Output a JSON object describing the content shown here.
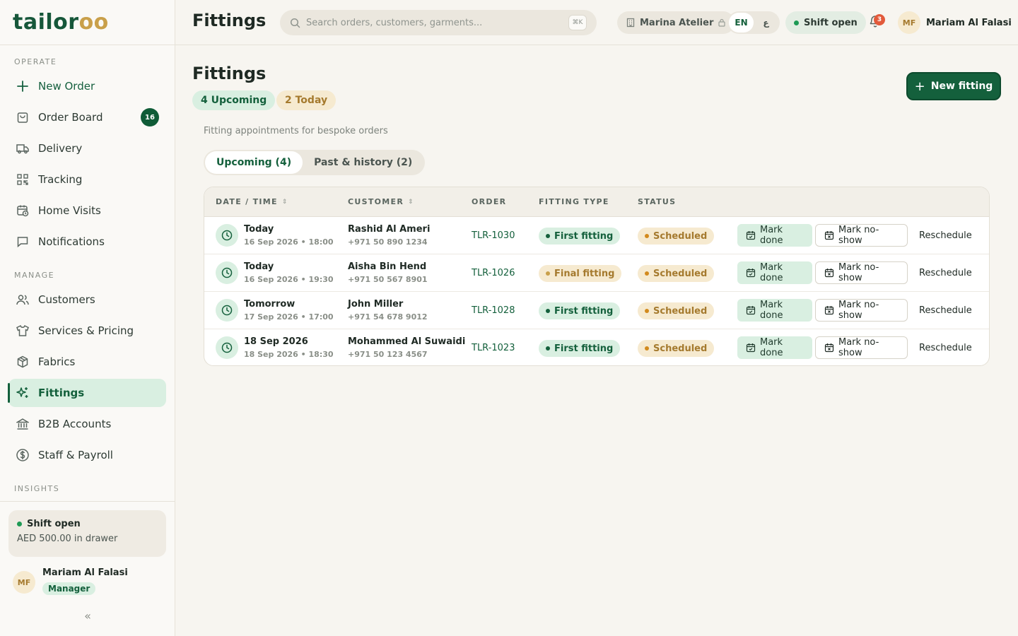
{
  "brand": {
    "logo_main": "tailor",
    "logo_accent": "oo"
  },
  "sidebar": {
    "sections": {
      "operate": "OPERATE",
      "manage": "MANAGE",
      "insights": "INSIGHTS"
    },
    "items": {
      "new_order": "New Order",
      "order_board": "Order Board",
      "order_board_count": "16",
      "delivery": "Delivery",
      "tracking": "Tracking",
      "home_visits": "Home Visits",
      "notifications": "Notifications",
      "customers": "Customers",
      "services": "Services & Pricing",
      "fabrics": "Fabrics",
      "fittings": "Fittings",
      "b2b": "B2B Accounts",
      "staff": "Staff & Payroll"
    },
    "shift": {
      "status": "Shift open",
      "drawer": "AED 500.00 in drawer"
    },
    "user": {
      "initials": "MF",
      "name": "Mariam Al Falasi",
      "role": "Manager"
    },
    "collapse_glyph": "«"
  },
  "topbar": {
    "title": "Fittings",
    "search_placeholder": "Search orders, customers, garments...",
    "search_shortcut": "⌘K",
    "atelier": "Marina Atelier",
    "lang_en": "EN",
    "lang_ar": "ع",
    "shift": "Shift open",
    "notif_count": "3",
    "user_initials": "MF",
    "user_name": "Mariam Al Falasi"
  },
  "page": {
    "title": "Fittings",
    "upcoming_pill": "4 Upcoming",
    "today_pill": "2 Today",
    "new_button": "New fitting",
    "subtitle": "Fitting appointments for bespoke orders",
    "tabs": {
      "upcoming": "Upcoming (4)",
      "past": "Past & history (2)"
    }
  },
  "table": {
    "headers": {
      "date": "DATE / TIME",
      "customer": "CUSTOMER",
      "order": "ORDER",
      "type": "FITTING TYPE",
      "status": "STATUS"
    },
    "actions": {
      "done": "Mark done",
      "noshow": "Mark no-show",
      "reschedule": "Reschedule"
    },
    "rows": [
      {
        "day": "Today",
        "datetime": "16 Sep 2026 • 18:00",
        "customer": "Rashid Al Ameri",
        "phone": "+971 50 890 1234",
        "order": "TLR-1030",
        "type": "First fitting",
        "status": "Scheduled"
      },
      {
        "day": "Today",
        "datetime": "16 Sep 2026 • 19:30",
        "customer": "Aisha Bin Hend",
        "phone": "+971 50 567 8901",
        "order": "TLR-1026",
        "type": "Final fitting",
        "status": "Scheduled"
      },
      {
        "day": "Tomorrow",
        "datetime": "17 Sep 2026 • 17:00",
        "customer": "John Miller",
        "phone": "+971 54 678 9012",
        "order": "TLR-1028",
        "type": "First fitting",
        "status": "Scheduled"
      },
      {
        "day": "18 Sep 2026",
        "datetime": "18 Sep 2026 • 18:30",
        "customer": "Mohammed Al Suwaidi",
        "phone": "+971 50 123 4567",
        "order": "TLR-1023",
        "type": "First fitting",
        "status": "Scheduled"
      }
    ]
  }
}
